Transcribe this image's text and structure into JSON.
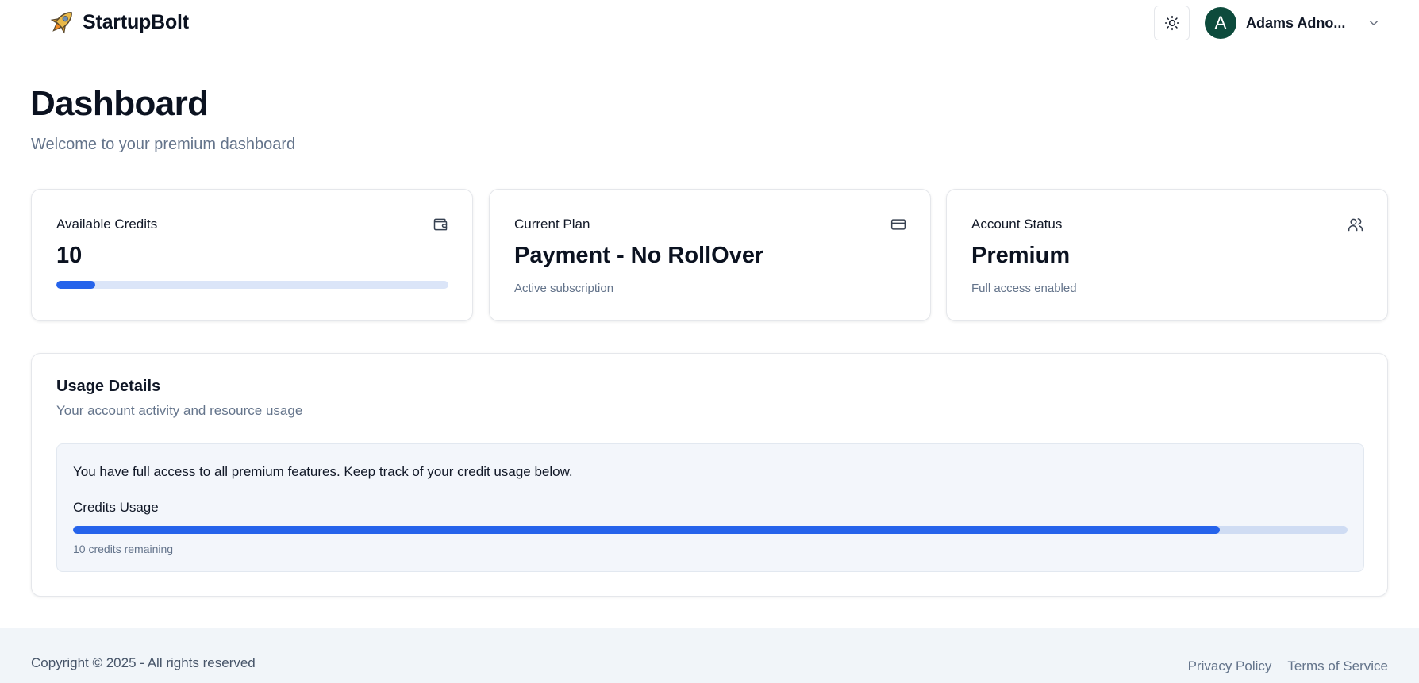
{
  "header": {
    "brand_name": "StartupBolt",
    "brand_icon": "rocket-icon",
    "theme_toggle_icon": "sun-icon",
    "user": {
      "avatar_initial": "A",
      "name": "Adams Adno...",
      "avatar_color": "#0d4b3c"
    }
  },
  "page": {
    "title": "Dashboard",
    "subtitle": "Welcome to your premium dashboard"
  },
  "stats": [
    {
      "label": "Available Credits",
      "value": "10",
      "icon": "wallet-icon",
      "progress_percent": 10
    },
    {
      "label": "Current Plan",
      "value": "Payment - No RollOver",
      "note": "Active subscription",
      "icon": "credit-card-icon"
    },
    {
      "label": "Account Status",
      "value": "Premium",
      "note": "Full access enabled",
      "icon": "users-icon"
    }
  ],
  "usage": {
    "title": "Usage Details",
    "subtitle": "Your account activity and resource usage",
    "message": "You have full access to all premium features. Keep track of your credit usage below.",
    "progress_label": "Credits Usage",
    "progress_percent": 90,
    "remaining_text": "10 credits remaining"
  },
  "footer": {
    "copyright": "Copyright © 2025 - All rights reserved",
    "links": [
      "Privacy Policy",
      "Terms of Service"
    ]
  },
  "colors": {
    "accent": "#2563eb",
    "progress_track": "#dbe5f8",
    "muted_text": "#64748b",
    "footer_bg": "#f1f5f9"
  }
}
